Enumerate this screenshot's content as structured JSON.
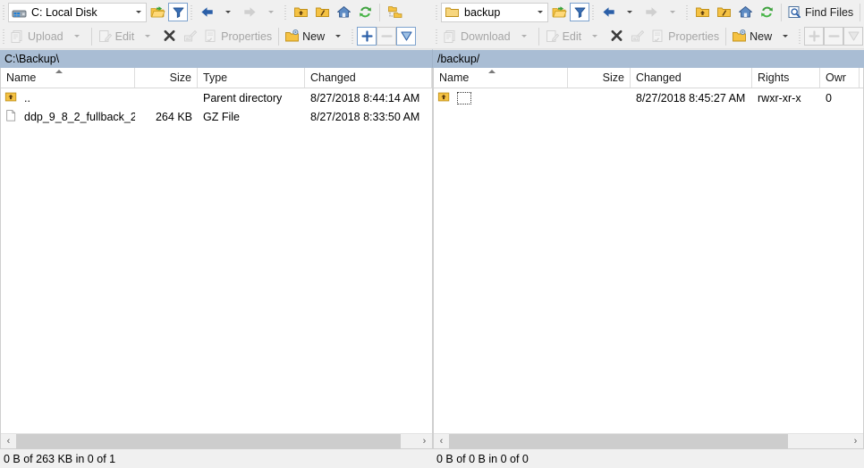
{
  "left_panel": {
    "address": {
      "value": "C: Local Disk",
      "icon": "local-disk-icon"
    },
    "path": "C:\\Backup\\",
    "toolbar_row1": [
      {
        "name": "open-directory-icon",
        "label": "",
        "enabled": true
      },
      {
        "name": "filter-icon",
        "label": "",
        "enabled": true
      },
      {
        "name": "back-icon",
        "label": "",
        "enabled": true
      },
      {
        "name": "forward-icon",
        "label": "",
        "enabled": false
      },
      {
        "name": "parent-directory-icon",
        "label": "",
        "enabled": true
      },
      {
        "name": "root-directory-icon",
        "label": "",
        "enabled": true
      },
      {
        "name": "home-directory-icon",
        "label": "",
        "enabled": true
      },
      {
        "name": "refresh-icon",
        "label": "",
        "enabled": true
      },
      {
        "name": "directory-tree-icon",
        "label": "",
        "enabled": true
      }
    ],
    "toolbar_row2": {
      "upload_label": "Upload",
      "edit_label": "Edit",
      "properties_label": "Properties",
      "new_label": "New"
    },
    "columns": [
      {
        "key": "name",
        "label": "Name",
        "width": 150,
        "align": "left",
        "sorted": true
      },
      {
        "key": "size",
        "label": "Size",
        "width": 70,
        "align": "right"
      },
      {
        "key": "type",
        "label": "Type",
        "width": 120,
        "align": "left"
      },
      {
        "key": "changed",
        "label": "Changed",
        "width": 142,
        "align": "left"
      }
    ],
    "rows": [
      {
        "icon": "parent-folder-icon",
        "name": "..",
        "size": "",
        "type": "Parent directory",
        "changed": "8/27/2018  8:44:14 AM",
        "focused": false
      },
      {
        "icon": "file-icon",
        "name": "ddp_9_8_2_fullback_2...",
        "size": "264 KB",
        "type": "GZ File",
        "changed": "8/27/2018  8:33:50 AM",
        "focused": false
      }
    ],
    "scrollbar": {
      "left_arrow": "‹",
      "right_arrow": "›",
      "thumb_start_pct": 0,
      "thumb_width_pct": 96
    },
    "status": "0 B of 263 KB in 0 of 1"
  },
  "right_panel": {
    "address": {
      "value": "backup",
      "icon": "remote-folder-icon"
    },
    "path": "/backup/",
    "find_files_label": "Find Files",
    "toolbar_row2": {
      "download_label": "Download",
      "edit_label": "Edit",
      "properties_label": "Properties",
      "new_label": "New"
    },
    "columns": [
      {
        "key": "name",
        "label": "Name",
        "width": 150,
        "align": "left",
        "sorted": true
      },
      {
        "key": "size",
        "label": "Size",
        "width": 70,
        "align": "right"
      },
      {
        "key": "changed",
        "label": "Changed",
        "width": 136,
        "align": "left"
      },
      {
        "key": "rights",
        "label": "Rights",
        "width": 76,
        "align": "left"
      },
      {
        "key": "owner",
        "label": "Owr",
        "width": 44,
        "align": "left"
      }
    ],
    "rows": [
      {
        "icon": "parent-folder-icon",
        "name": "",
        "size": "",
        "changed": "8/27/2018 8:45:27 AM",
        "rights": "rwxr-xr-x",
        "owner": "0",
        "focused": true
      }
    ],
    "scrollbar": {
      "left_arrow": "‹",
      "right_arrow": "›",
      "thumb_start_pct": 0,
      "thumb_width_pct": 85
    },
    "status": "0 B of 0 B in 0 of 0"
  },
  "colors": {
    "path_bar": "#a9bdd4",
    "toolbar_bg": "#f0f0f0",
    "list_bg": "#ffffff",
    "folder_yellow": "#f5c243",
    "accent_blue": "#2b5fa8",
    "green": "#3fa23f"
  }
}
